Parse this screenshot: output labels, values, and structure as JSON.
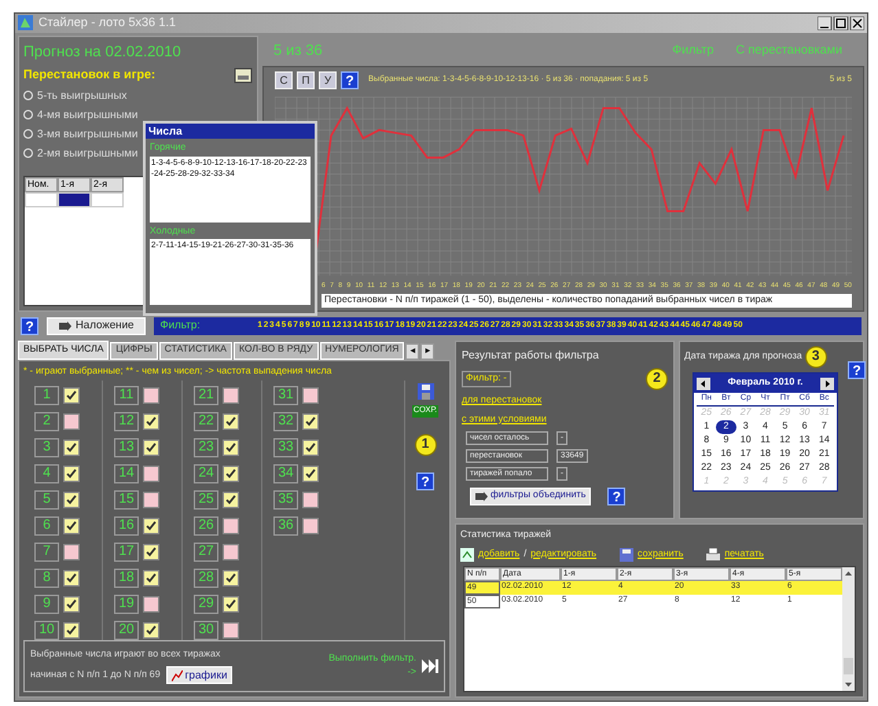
{
  "window": {
    "title": "Стайлер - лото 5х36 1.1"
  },
  "forecast": {
    "title": "Прогноз на 02.02.2010",
    "subtitle": "Перестановок в игре:",
    "options": [
      {
        "label": "5-ть выигрышных",
        "selected": false
      },
      {
        "label": "4-мя выигрышными",
        "selected": false
      },
      {
        "label": "3-мя выигрышными",
        "selected": false
      },
      {
        "label": "2-мя выигрышными",
        "selected": false
      }
    ],
    "table": {
      "columns": [
        "Ном.",
        "1-я",
        "2-я"
      ],
      "rows": [
        {
          "cells": [
            {
              "selected": false
            },
            {
              "selected": true
            },
            {
              "selected": false
            }
          ]
        }
      ]
    }
  },
  "numbers_popup": {
    "title": "Числа",
    "groups": [
      {
        "label": "Горячие",
        "text": "1-3-4-5-6-8-9-10-12-13-16-17-18-20-22-23-24-25-28-29-32-33-34"
      },
      {
        "label": "Холодные",
        "text": "2-7-11-14-15-19-21-26-27-30-31-35-36"
      }
    ]
  },
  "chart": {
    "title": "5 из 36",
    "status": [
      "Фильтр",
      "С перестановками"
    ],
    "buttons": [
      "С",
      "П",
      "У",
      "?"
    ],
    "caption": "Выбранные числа: 1-3-4-5-6-8-9-10-12-13-16 · 5 из 36 · попадания: 5 из 5",
    "corner": "5 из 5",
    "x_labels": [
      "6",
      "7",
      "8",
      "9",
      "10",
      "11",
      "12",
      "13",
      "14",
      "15",
      "16",
      "17",
      "18",
      "19",
      "20",
      "21",
      "22",
      "23",
      "24",
      "25",
      "26",
      "27",
      "28",
      "29",
      "30",
      "31",
      "32",
      "33",
      "34",
      "35",
      "36",
      "37",
      "38",
      "39",
      "40",
      "41",
      "42",
      "43",
      "44",
      "45",
      "46",
      "47",
      "48",
      "49",
      "50"
    ],
    "footer": "Перестановки - N п/п тиражей (1 - 50), выделены - количество попаданий выбранных чисел в тираж"
  },
  "toolbar": {
    "help": "?",
    "overlay_button": "Наложение",
    "filter_label": "Фильтр:",
    "filter_numbers": [
      "1",
      "2",
      "3",
      "4",
      "5",
      "6",
      "7",
      "8",
      "9",
      "10",
      "11",
      "12",
      "13",
      "14",
      "15",
      "16",
      "17",
      "18",
      "19",
      "20",
      "21",
      "22",
      "23",
      "24",
      "25",
      "26",
      "27",
      "28",
      "29",
      "30",
      "31",
      "32",
      "33",
      "34",
      "35",
      "36",
      "37",
      "38",
      "39",
      "40",
      "41",
      "42",
      "43",
      "44",
      "45",
      "46",
      "47",
      "48",
      "49",
      "50"
    ]
  },
  "tabs": [
    {
      "label": "ВЫБРАТЬ ЧИСЛА",
      "selected": true
    },
    {
      "label": "ЦИФРЫ",
      "selected": false
    },
    {
      "label": "СТАТИСТИКА",
      "selected": false
    },
    {
      "label": "КОЛ-ВО В РЯДУ",
      "selected": false
    },
    {
      "label": "НУМЕРОЛОГИЯ",
      "selected": false
    }
  ],
  "tab_scroll": [
    "◄",
    "►"
  ],
  "numbers_panel": {
    "legend": "* - играют выбранные; ** - чем из чисел; -> частота выпадения числа",
    "save_label": "СОХР.",
    "badge": "1",
    "help": "?",
    "columns": [
      [
        {
          "number": "1",
          "checked": true
        },
        {
          "number": "2",
          "checked": false
        },
        {
          "number": "3",
          "checked": true
        },
        {
          "number": "4",
          "checked": true
        },
        {
          "number": "5",
          "checked": true
        },
        {
          "number": "6",
          "checked": true
        },
        {
          "number": "7",
          "checked": false
        },
        {
          "number": "8",
          "checked": true
        },
        {
          "number": "9",
          "checked": true
        },
        {
          "number": "10",
          "checked": true
        }
      ],
      [
        {
          "number": "11",
          "checked": false
        },
        {
          "number": "12",
          "checked": true
        },
        {
          "number": "13",
          "checked": true
        },
        {
          "number": "14",
          "checked": false
        },
        {
          "number": "15",
          "checked": false
        },
        {
          "number": "16",
          "checked": true
        },
        {
          "number": "17",
          "checked": true
        },
        {
          "number": "18",
          "checked": true
        },
        {
          "number": "19",
          "checked": false
        },
        {
          "number": "20",
          "checked": true
        }
      ],
      [
        {
          "number": "21",
          "checked": false
        },
        {
          "number": "22",
          "checked": true
        },
        {
          "number": "23",
          "checked": true
        },
        {
          "number": "24",
          "checked": true
        },
        {
          "number": "25",
          "checked": true
        },
        {
          "number": "26",
          "checked": false
        },
        {
          "number": "27",
          "checked": false
        },
        {
          "number": "28",
          "checked": true
        },
        {
          "number": "29",
          "checked": true
        },
        {
          "number": "30",
          "checked": false
        }
      ],
      [
        {
          "number": "31",
          "checked": false
        },
        {
          "number": "32",
          "checked": true
        },
        {
          "number": "33",
          "checked": true
        },
        {
          "number": "34",
          "checked": true
        },
        {
          "number": "35",
          "checked": false
        },
        {
          "number": "36",
          "checked": false
        }
      ]
    ],
    "note": [
      "Выбранные числа играют во всех тиражах",
      "начиная с N п/п 1 до N п/п 69"
    ],
    "graph_button": "графики",
    "run_label": [
      "Выполнить фильтр.",
      "-> "
    ]
  },
  "filter_result": {
    "title": "Результат работы фильтра",
    "filter": "Фильтр: -",
    "lines": [
      "для перестановок",
      "с этими условиями"
    ],
    "rows": [
      {
        "label": "чисел осталось",
        "value": "-"
      },
      {
        "label": "перестановок",
        "value": "33649"
      },
      {
        "label": "тиражей попало",
        "value": "-"
      }
    ],
    "button": "фильтры объединить",
    "help": "?",
    "badge": "2"
  },
  "calendar": {
    "title": "Дата тиража для прогноза",
    "badge": "3",
    "help": "?",
    "month": "Февраль 2010 г.",
    "weekdays": [
      "Пн",
      "Вт",
      "Ср",
      "Чт",
      "Пт",
      "Сб",
      "Вс"
    ],
    "days": [
      {
        "day": "25",
        "other_month": true,
        "selected": false
      },
      {
        "day": "26",
        "other_month": true,
        "selected": false
      },
      {
        "day": "27",
        "other_month": true,
        "selected": false
      },
      {
        "day": "28",
        "other_month": true,
        "selected": false
      },
      {
        "day": "29",
        "other_month": true,
        "selected": false
      },
      {
        "day": "30",
        "other_month": true,
        "selected": false
      },
      {
        "day": "31",
        "other_month": true,
        "selected": false
      },
      {
        "day": "1",
        "other_month": false,
        "selected": false
      },
      {
        "day": "2",
        "other_month": false,
        "selected": true
      },
      {
        "day": "3",
        "other_month": false,
        "selected": false
      },
      {
        "day": "4",
        "other_month": false,
        "selected": false
      },
      {
        "day": "5",
        "other_month": false,
        "selected": false
      },
      {
        "day": "6",
        "other_month": false,
        "selected": false
      },
      {
        "day": "7",
        "other_month": false,
        "selected": false
      },
      {
        "day": "8",
        "other_month": false,
        "selected": false
      },
      {
        "day": "9",
        "other_month": false,
        "selected": false
      },
      {
        "day": "10",
        "other_month": false,
        "selected": false
      },
      {
        "day": "11",
        "other_month": false,
        "selected": false
      },
      {
        "day": "12",
        "other_month": false,
        "selected": false
      },
      {
        "day": "13",
        "other_month": false,
        "selected": false
      },
      {
        "day": "14",
        "other_month": false,
        "selected": false
      },
      {
        "day": "15",
        "other_month": false,
        "selected": false
      },
      {
        "day": "16",
        "other_month": false,
        "selected": false
      },
      {
        "day": "17",
        "other_month": false,
        "selected": false
      },
      {
        "day": "18",
        "other_month": false,
        "selected": false
      },
      {
        "day": "19",
        "other_month": false,
        "selected": false
      },
      {
        "day": "20",
        "other_month": false,
        "selected": false
      },
      {
        "day": "21",
        "other_month": false,
        "selected": false
      },
      {
        "day": "22",
        "other_month": false,
        "selected": false
      },
      {
        "day": "23",
        "other_month": false,
        "selected": false
      },
      {
        "day": "24",
        "other_month": false,
        "selected": false
      },
      {
        "day": "25",
        "other_month": false,
        "selected": false
      },
      {
        "day": "26",
        "other_month": false,
        "selected": false
      },
      {
        "day": "27",
        "other_month": false,
        "selected": false
      },
      {
        "day": "28",
        "other_month": false,
        "selected": false
      },
      {
        "day": "1",
        "other_month": true,
        "selected": false
      },
      {
        "day": "2",
        "other_month": true,
        "selected": false
      },
      {
        "day": "3",
        "other_month": true,
        "selected": false
      },
      {
        "day": "4",
        "other_month": true,
        "selected": false
      },
      {
        "day": "5",
        "other_month": true,
        "selected": false
      },
      {
        "day": "6",
        "other_month": true,
        "selected": false
      },
      {
        "day": "7",
        "other_month": true,
        "selected": false
      }
    ]
  },
  "stats": {
    "title": "Статистика тиражей",
    "actions": [
      {
        "kind": "add",
        "label": "добавить"
      },
      {
        "kind": "separator",
        "label": "/"
      },
      {
        "kind": "edit",
        "label": "редактировать"
      },
      {
        "kind": "save",
        "label": "сохранить"
      },
      {
        "kind": "print",
        "label": "печатать"
      }
    ],
    "columns": [
      "N п/п",
      "Дата",
      "1-я",
      "2-я",
      "3-я",
      "4-я",
      "5-я"
    ],
    "rows": [
      {
        "cells": [
          "49",
          "02.02.2010",
          "12",
          "4",
          "20",
          "33",
          "6"
        ],
        "selected": true
      },
      {
        "cells": [
          "50",
          "03.02.2010",
          "5",
          "27",
          "8",
          "12",
          "1"
        ],
        "selected": false
      }
    ]
  }
}
